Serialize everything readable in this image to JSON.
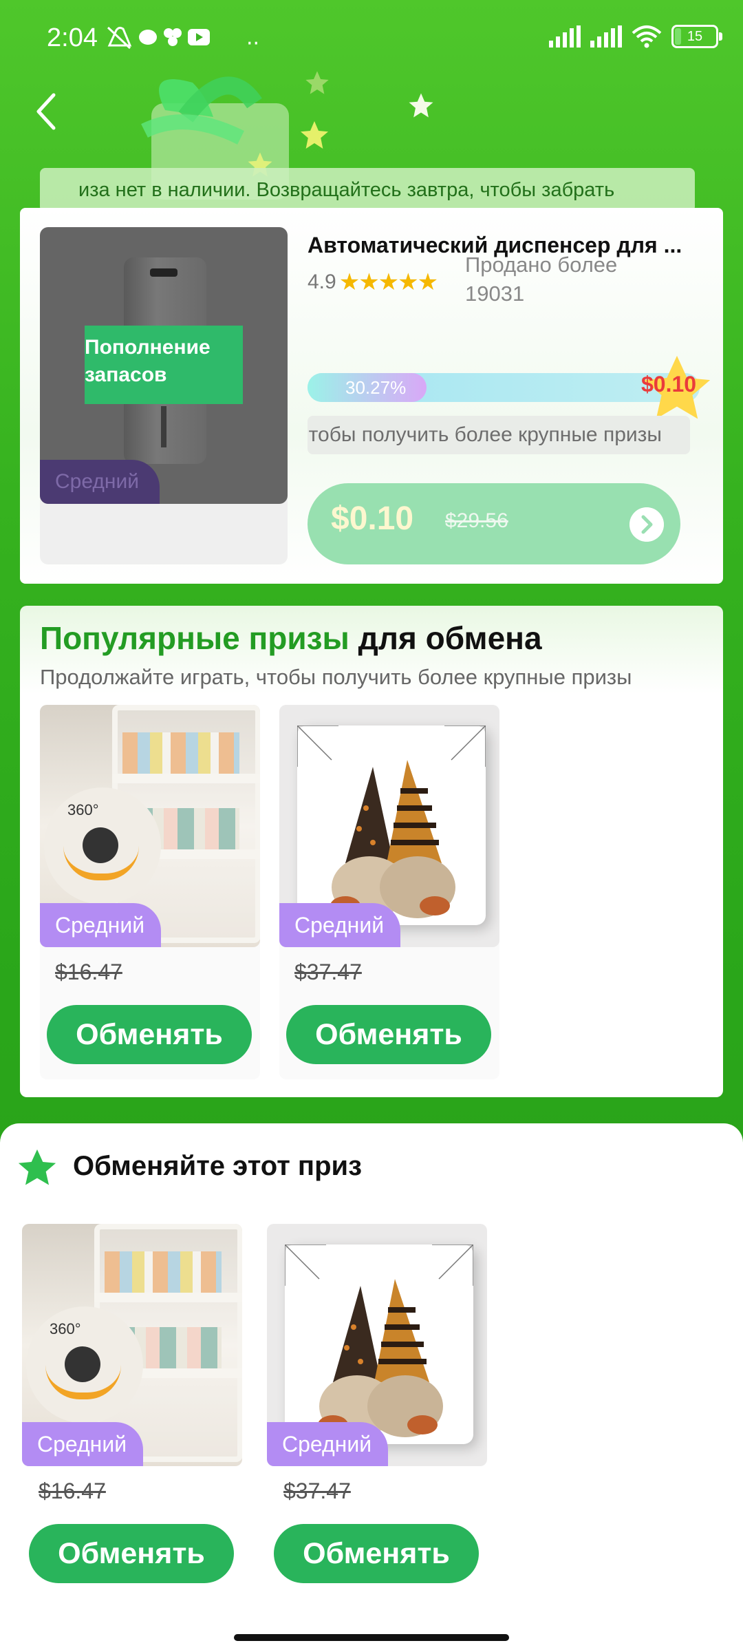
{
  "status_bar": {
    "time": "2:04",
    "battery": "15"
  },
  "notice": {
    "text": "иза нет в наличии. Возвращайтесь завтра, чтобы забрать"
  },
  "featured": {
    "title": "Автоматический диспенсер для ...",
    "rating": "4.9",
    "sold": "Продано более 19031",
    "overlay_label": "Пополнение запасов",
    "tier_label": "Средний",
    "progress_label": "30.27%",
    "progress": 0.3027,
    "prize_value": "$0.10",
    "hint": "чтобы получить более крупные призы",
    "price": "$0.10",
    "old_price": "$29.56"
  },
  "popular": {
    "title_green": "Популярные призы",
    "title_rest": " для обмена",
    "subtitle": "Продолжайте играть, чтобы получить более крупные призы",
    "items": [
      {
        "tier": "Средний",
        "old_price": "$16.47",
        "button": "Обменять",
        "image": "rolling-shelf-cart",
        "badge_text": "360°"
      },
      {
        "tier": "Средний",
        "old_price": "$37.47",
        "button": "Обменять",
        "image": "gnome-pillow"
      }
    ]
  },
  "sheet": {
    "title": "Обменяйте этот приз",
    "items": [
      {
        "tier": "Средний",
        "old_price": "$16.47",
        "button": "Обменять",
        "image": "rolling-shelf-cart",
        "badge_text": "360°"
      },
      {
        "tier": "Средний",
        "old_price": "$37.47",
        "button": "Обменять",
        "image": "gnome-pillow"
      }
    ]
  },
  "colors": {
    "accent_green": "#29b45b",
    "tier_purple": "#b38cf3",
    "prize_red": "#ea3b3b"
  }
}
